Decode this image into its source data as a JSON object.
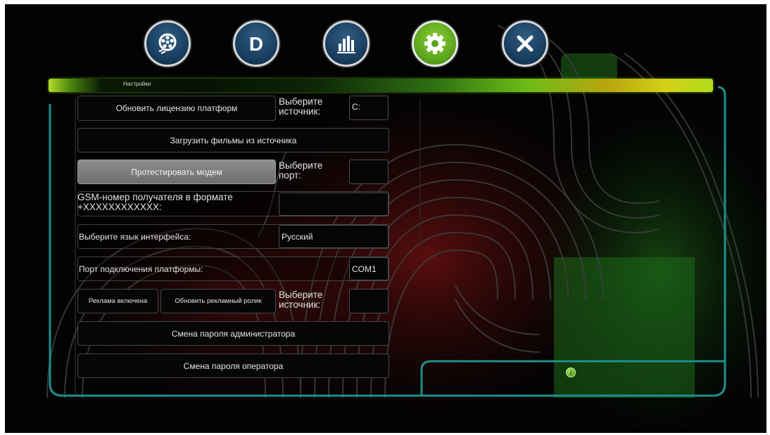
{
  "toolbar": {
    "buttons": [
      {
        "icon": "film-reel-icon",
        "active": false
      },
      {
        "icon": "d-letter-icon",
        "label": "D",
        "active": false
      },
      {
        "icon": "bar-chart-icon",
        "active": false
      },
      {
        "icon": "gear-icon",
        "active": true
      },
      {
        "icon": "close-icon",
        "active": false
      }
    ]
  },
  "header": {
    "title": "Настройки"
  },
  "settings": {
    "update_license_label": "Обновить лицензию платформ",
    "source_label_1": "Выберите источник:",
    "source_value_1": "C:",
    "load_movies_label": "Загрузить фильмы из источника",
    "test_modem_label": "Протестировать модем",
    "port_label": "Выберите порт:",
    "port_value": "",
    "gsm_label": "GSM-номер получателя в формате +XXXXXXXXXXXX:",
    "gsm_value": "",
    "language_label": "Выберите язык интерфейса:",
    "language_value": "Русский",
    "platform_port_label": "Порт подключения платформы:",
    "platform_port_value": "COM1",
    "ads_enabled_label": "Реклама включена",
    "update_ad_label": "Обновить рекламный ролик",
    "source_label_2": "Выберите источник:",
    "source_value_2": "",
    "admin_password_label": "Смена пароля администратора",
    "operator_password_label": "Смена пароля оператора"
  },
  "status": {
    "info_icon": "info-icon",
    "info_glyph": "i"
  },
  "colors": {
    "accent_green": "#5aa31c",
    "frame_teal": "#1f8f8d",
    "nav_blue": "#1b4266",
    "background": "#030303"
  }
}
